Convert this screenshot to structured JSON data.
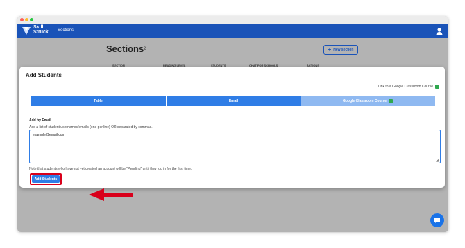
{
  "app": {
    "logo_line1": "Skill",
    "logo_line2": "Struck",
    "title": "Sections"
  },
  "page": {
    "heading": "Sections",
    "count": "2",
    "new_section_label": "New section",
    "columns": [
      "SECTION",
      "READING LEVEL",
      "STUDENTS",
      "CHAT FOR SCHOOLS",
      "ACTIONS"
    ]
  },
  "modal": {
    "title": "Add Students",
    "google_link": "Link to a Google Classroom Course",
    "tabs": [
      "Table",
      "Email",
      "Google Classroom Course"
    ],
    "section_label": "Add by Email",
    "hint": "Add a list of student usernames/emails (one per line) OR separated by commas.",
    "email_value": "example@email.com",
    "note": "Note that students who have not yet created an account will be \"Pending\" until they log in for the first time.",
    "submit_label": "Add Students"
  },
  "icons": {
    "user": "user-icon",
    "chat": "chat-icon",
    "google_classroom": "google-classroom-icon"
  },
  "colors": {
    "brand": "#1a53b8",
    "accent": "#2f7de6",
    "highlight": "#d9001b"
  }
}
